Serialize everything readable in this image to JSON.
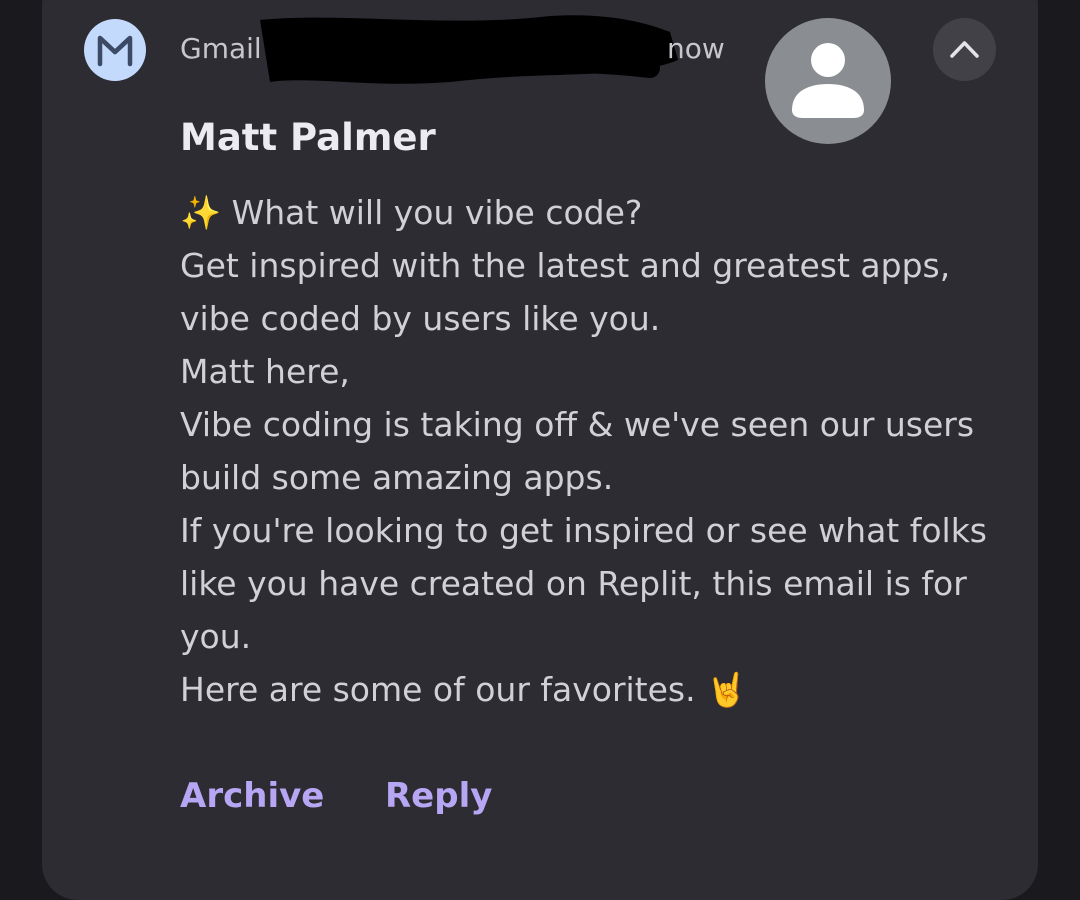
{
  "notification": {
    "app_name": "Gmail",
    "time": "now",
    "icons": {
      "app": "gmail-icon",
      "avatar": "person-avatar-icon",
      "collapse": "chevron-up-icon"
    },
    "colors": {
      "background": "#2c2c32",
      "accent": "#b6a6f4",
      "app_icon_bg": "#c3dafd"
    },
    "sender": "Matt Palmer",
    "body_lines": [
      "✨ What will you vibe code?",
      "Get inspired with the latest and greatest apps,",
      "vibe coded by users like you.",
      "Matt here,",
      "Vibe coding is taking off & we've seen our users",
      "build some amazing apps.",
      "If you're looking to get inspired or see what folks",
      "like you have created on Replit, this email is for",
      "you.",
      "Here are some of our favorites. 🤘"
    ],
    "actions": {
      "archive": "Archive",
      "reply": "Reply"
    }
  }
}
